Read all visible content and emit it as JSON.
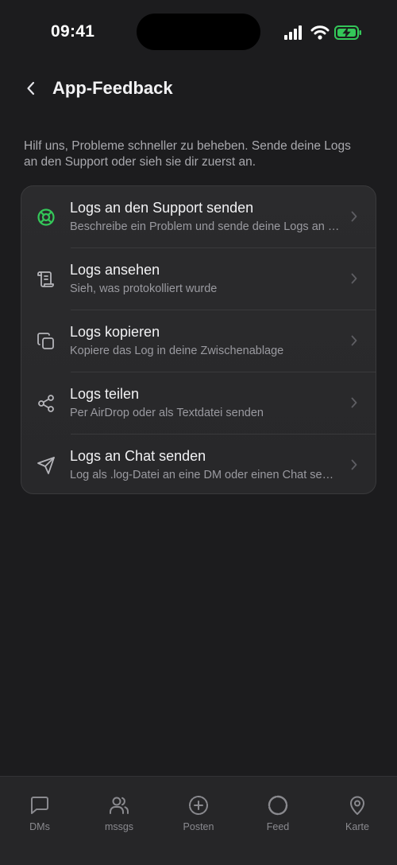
{
  "status_bar": {
    "time": "09:41",
    "icons": [
      "cellular-signal-icon",
      "wifi-icon",
      "battery-charging-icon"
    ],
    "battery_color": "#34c759"
  },
  "header": {
    "back_icon": "chevron-left-icon",
    "title": "App-Feedback"
  },
  "description": "Hilf uns, Probleme schneller zu beheben. Sende deine Logs an den Support oder sieh sie dir zuerst an.",
  "actions": [
    {
      "icon": "lifebuoy-icon",
      "title": "Logs an den Support senden",
      "subtitle": "Beschreibe ein Problem und sende deine Logs an den Support",
      "icon_color": "#34c759"
    },
    {
      "icon": "scroll-icon",
      "title": "Logs ansehen",
      "subtitle": "Sieh, was protokolliert wurde",
      "icon_color": "#b5b5ba"
    },
    {
      "icon": "copy-icon",
      "title": "Logs kopieren",
      "subtitle": "Kopiere das Log in deine Zwischenablage",
      "icon_color": "#b5b5ba"
    },
    {
      "icon": "share-icon",
      "title": "Logs teilen",
      "subtitle": "Per AirDrop oder als Textdatei senden",
      "icon_color": "#b5b5ba"
    },
    {
      "icon": "send-icon",
      "title": "Logs an Chat senden",
      "subtitle": "Log als .log-Datei an eine DM oder einen Chat senden",
      "icon_color": "#b5b5ba"
    }
  ],
  "tab_bar": {
    "tabs": [
      {
        "icon": "message-square-icon",
        "label": "DMs"
      },
      {
        "icon": "users-icon",
        "label": "mssgs"
      },
      {
        "icon": "plus-circle-icon",
        "label": "Posten"
      },
      {
        "icon": "circle-dashed-icon",
        "label": "Feed"
      },
      {
        "icon": "map-pin-icon",
        "label": "Karte"
      }
    ],
    "inactive_color": "#8a8a8f"
  }
}
